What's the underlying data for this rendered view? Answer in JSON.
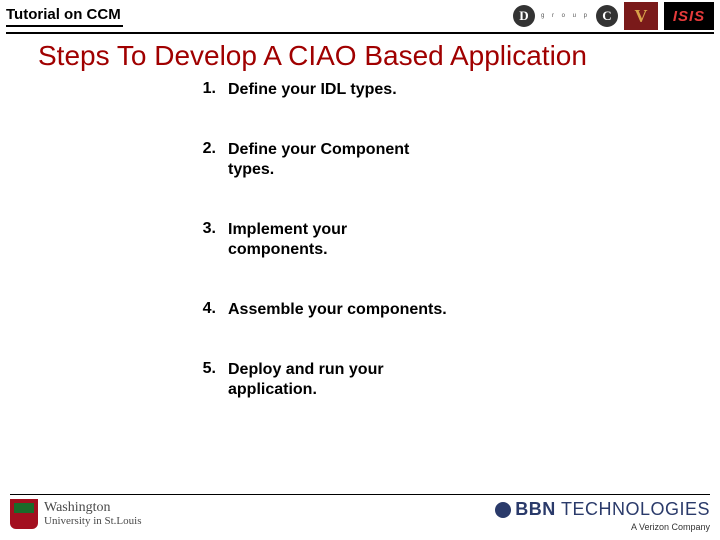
{
  "header": {
    "doc_title": "Tutorial on CCM",
    "doc_logo_letters": [
      "D",
      "C"
    ],
    "doc_logo_sub": "g r o u p",
    "v_badge": "V",
    "isis_badge": "ISIS"
  },
  "title": "Steps To Develop A CIAO Based Application",
  "steps": [
    {
      "n": "1.",
      "t": "Define your IDL types."
    },
    {
      "n": "2.",
      "t": "Define your Component types."
    },
    {
      "n": "3.",
      "t": "Implement your components."
    },
    {
      "n": "4.",
      "t": "Assemble your components."
    },
    {
      "n": "5.",
      "t": "Deploy and run your application."
    }
  ],
  "footer": {
    "wu_line1": "Washington",
    "wu_line2": "University in St.Louis",
    "bbn_bold": "BBN",
    "bbn_rest": " TECHNOLOGIES",
    "bbn_sub": "A Verizon Company"
  }
}
